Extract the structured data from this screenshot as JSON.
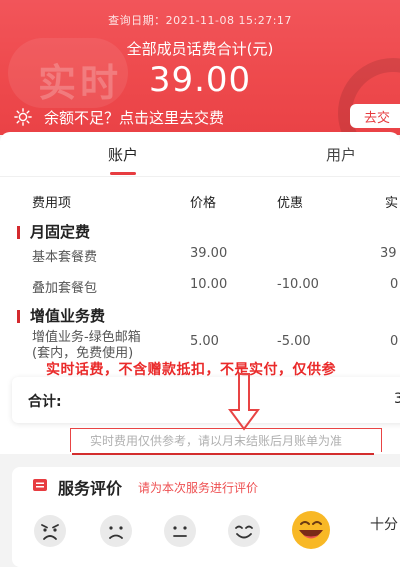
{
  "header": {
    "query_date": "查询日期：2021-11-08 15:27:17",
    "watermark": "实时",
    "total_label": "全部成员话费合计(元)",
    "total_amount": "39.00",
    "topup_text": "余额不足？点击这里去交费",
    "recharge_button": "去交"
  },
  "tabs": [
    {
      "label": "账户",
      "active": true
    },
    {
      "label": "用户",
      "active": false
    }
  ],
  "table": {
    "headers": [
      "费用项",
      "价格",
      "优惠",
      "实"
    ],
    "sections": [
      {
        "title": "月固定费",
        "rows": [
          {
            "item": "基本套餐费",
            "price": "39.00",
            "discount": "",
            "actual": "39"
          },
          {
            "item": "叠加套餐包",
            "price": "10.00",
            "discount": "-10.00",
            "actual": "0"
          }
        ]
      },
      {
        "title": "增值业务费",
        "rows": [
          {
            "item_line1": "增值业务-绿色邮箱",
            "item_line2": "(套内，免费使用)",
            "price": "5.00",
            "discount": "-5.00",
            "actual": "0"
          }
        ]
      }
    ]
  },
  "annotation": "实时话费，不含赠款抵扣，不是实付，仅供参",
  "total": {
    "label": "合计:",
    "value": "3"
  },
  "reference_note": "实时费用仅供参考，请以月末结账后月账单为准",
  "service": {
    "title": "服务评价",
    "subtitle": "请为本次服务进行评价",
    "right_text": "十分",
    "faces": [
      "angry-face-icon",
      "sad-face-icon",
      "neutral-face-icon",
      "smile-face-icon",
      "grin-face-icon"
    ]
  },
  "colors": {
    "brand_red": "#ee4a4d",
    "accent_red": "#e73c40",
    "annotation_red": "#ea2a2a"
  }
}
